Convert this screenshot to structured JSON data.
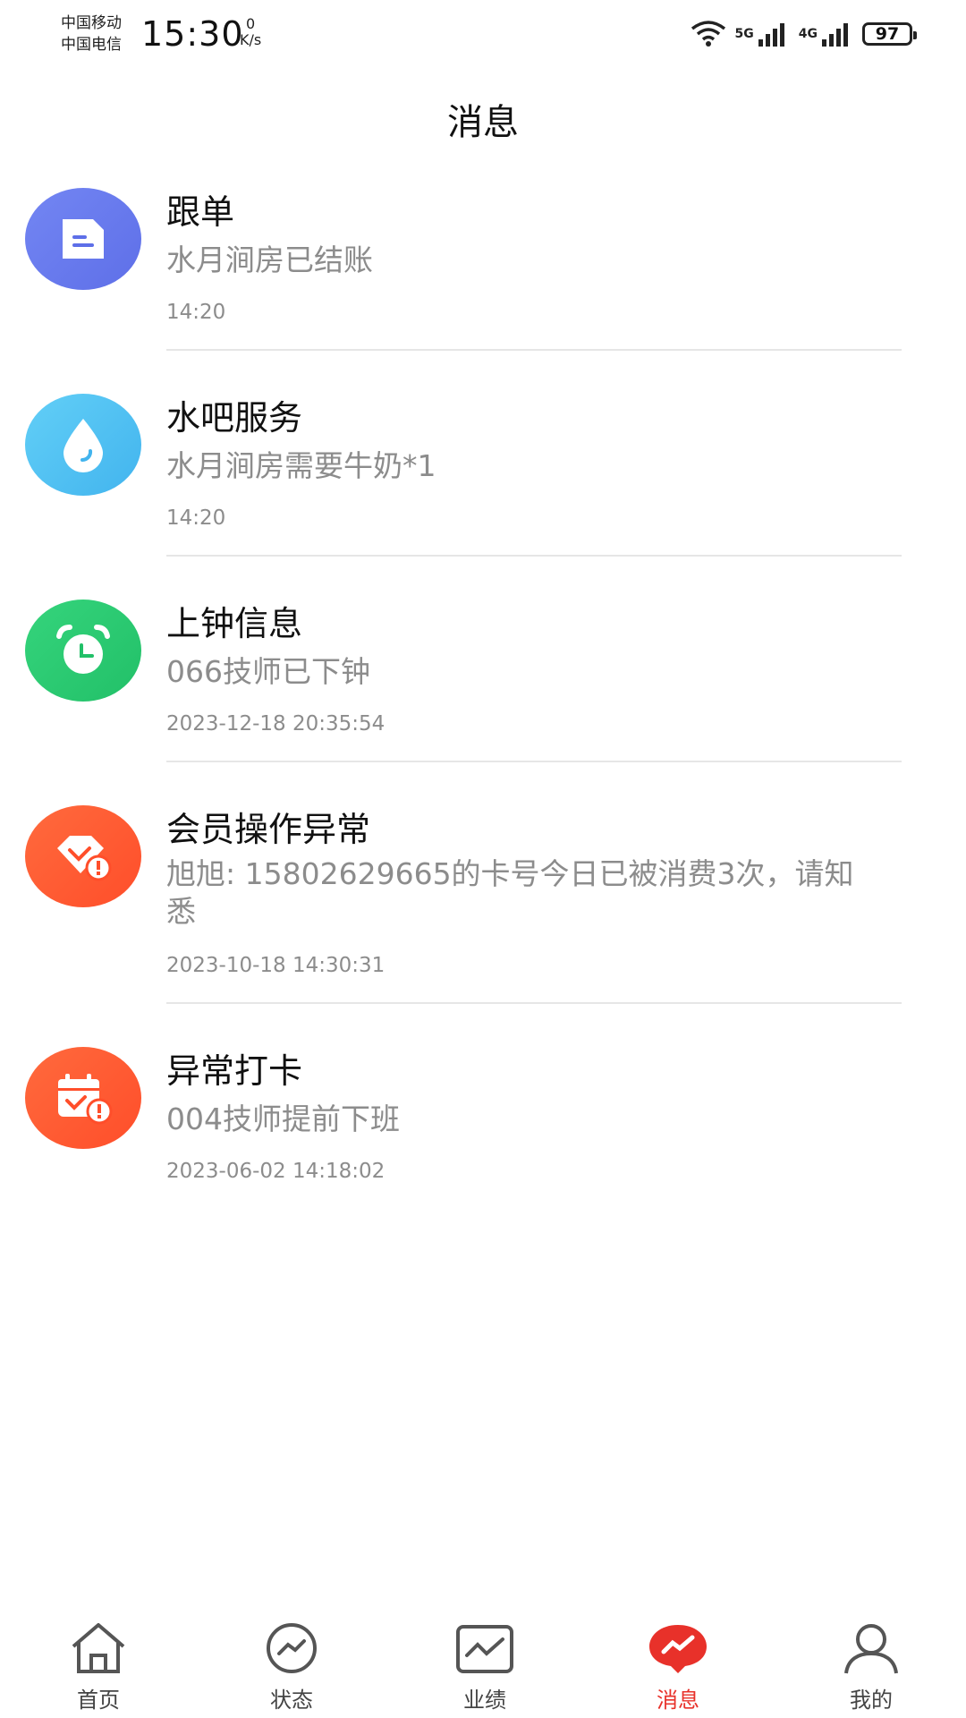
{
  "status_bar": {
    "carrier_1": "中国移动",
    "carrier_2": "中国电信",
    "time": "15:30",
    "net_speed_value": "0",
    "net_speed_unit": "K/s",
    "network_1": "5G",
    "network_2": "4G",
    "battery": "97"
  },
  "header": {
    "title": "消息"
  },
  "messages": [
    {
      "icon": "document-icon",
      "color": "#6A7DEF",
      "title": "跟单",
      "body": "水月涧房已结账",
      "time": "14:20"
    },
    {
      "icon": "water-drop-icon",
      "color": "#4FC2F2",
      "title": "水吧服务",
      "body": "水月涧房需要牛奶*1",
      "time": "14:20"
    },
    {
      "icon": "alarm-clock-icon",
      "color": "#2CCB72",
      "title": "上钟信息",
      "body": "066技师已下钟",
      "time": "2023-12-18 20:35:54"
    },
    {
      "icon": "member-alert-icon",
      "color": "#FF5B32",
      "title": "会员操作异常",
      "body": "旭旭: 15802629665的卡号今日已被消费3次，请知悉",
      "time": "2023-10-18 14:30:31"
    },
    {
      "icon": "calendar-alert-icon",
      "color": "#FF5B32",
      "title": "异常打卡",
      "body": "004技师提前下班",
      "time": "2023-06-02 14:18:02"
    }
  ],
  "tabbar": {
    "accent_color": "#E8312A",
    "tabs": [
      {
        "label": "首页",
        "icon": "home-icon"
      },
      {
        "label": "状态",
        "icon": "status-icon"
      },
      {
        "label": "业绩",
        "icon": "performance-icon"
      },
      {
        "label": "消息",
        "icon": "message-icon",
        "active": true
      },
      {
        "label": "我的",
        "icon": "profile-icon"
      }
    ]
  }
}
